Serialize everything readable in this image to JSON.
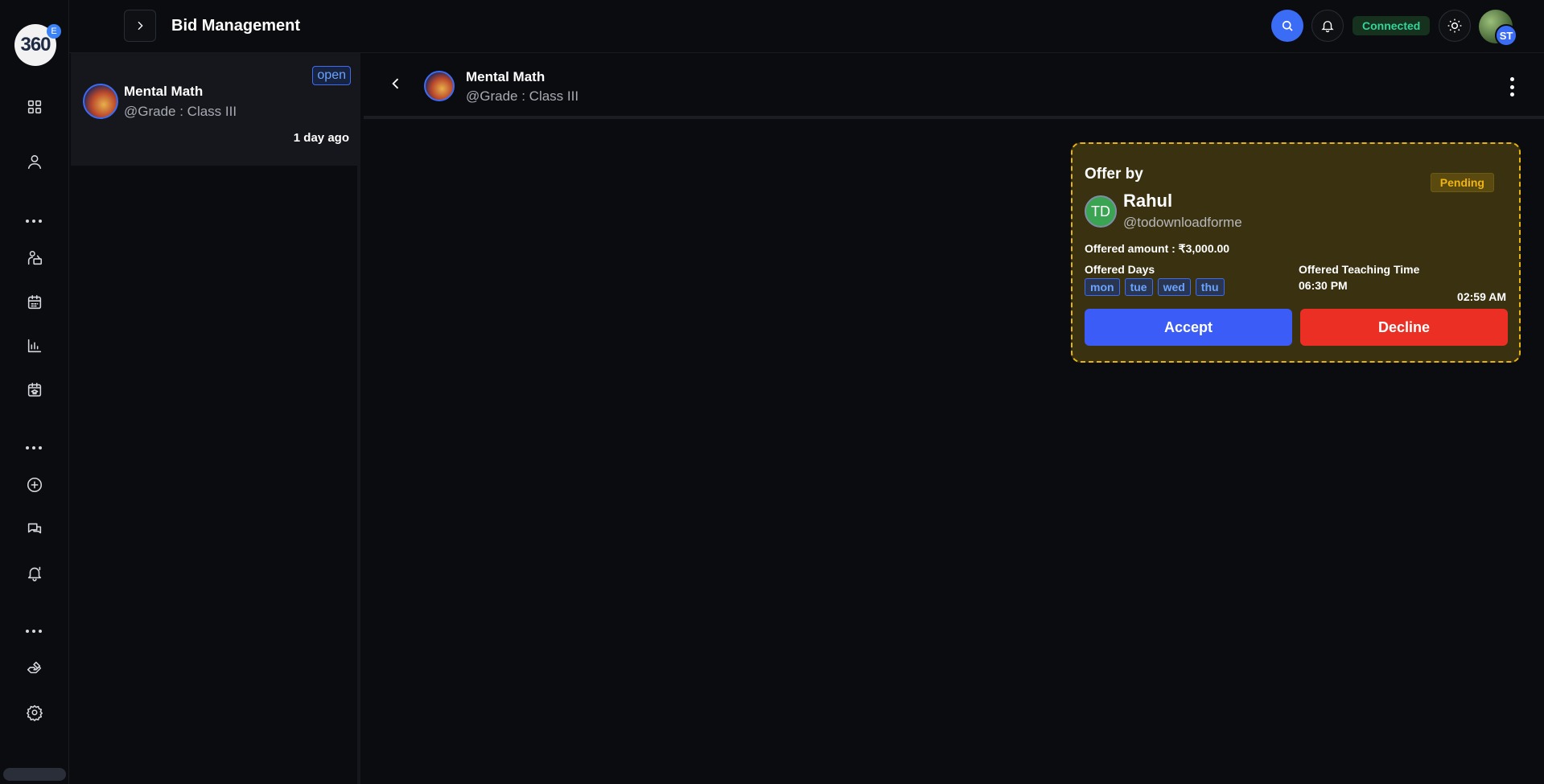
{
  "app": {
    "logo_text": "360",
    "logo_badge": "E",
    "page_title": "Bid Management"
  },
  "topbar": {
    "toggle_icon": "chevron-right-icon",
    "search_icon": "search-icon",
    "bell_icon": "bell-icon",
    "connection_status": "Connected",
    "theme_icon": "sun-icon",
    "user_initials": "ST"
  },
  "sidebar": {
    "icons": [
      "grid-icon",
      "user-icon",
      "more-dots-icon",
      "teacher-icon",
      "calendar-icon",
      "chart-icon",
      "class-calendar-icon",
      "more-dots-icon",
      "add-circle-icon",
      "chat-icon",
      "bell-alert-icon",
      "more-dots-icon",
      "bid-hand-icon",
      "settings-icon"
    ]
  },
  "bid_list": {
    "items": [
      {
        "title": "Mental Math",
        "subtitle": "@Grade : Class III",
        "status": "open",
        "time": "1 day ago"
      }
    ]
  },
  "chat": {
    "title": "Mental Math",
    "subtitle": "@Grade : Class III"
  },
  "offer": {
    "heading": "Offer by",
    "status": "Pending",
    "avatar_initials": "TD",
    "name": "Rahul",
    "handle": "@todownloadforme",
    "amount_text": "Offered amount : ₹3,000.00",
    "days_label": "Offered Days",
    "days": [
      "mon",
      "tue",
      "wed",
      "thu"
    ],
    "time_label": "Offered Teaching Time",
    "time_value": "06:30 PM",
    "sent_time": "02:59 AM",
    "accept_label": "Accept",
    "decline_label": "Decline"
  },
  "colors": {
    "accent": "#3b5cf6",
    "decline": "#ec2f24",
    "pending": "#f0b413",
    "connected": "#34d399",
    "background": "#0b0c10"
  }
}
